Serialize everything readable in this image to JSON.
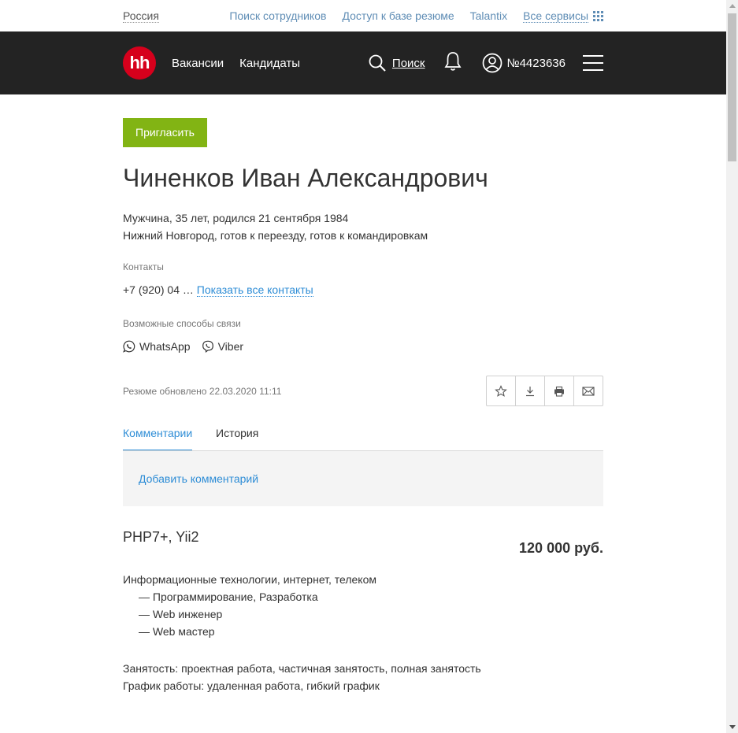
{
  "topbar": {
    "region": "Россия",
    "links": [
      "Поиск сотрудников",
      "Доступ к базе резюме",
      "Talantix"
    ],
    "all_services": "Все сервисы"
  },
  "header": {
    "logo": "hh",
    "nav": [
      "Вакансии",
      "Кандидаты"
    ],
    "search_label": "Поиск",
    "account_label": "№4423636"
  },
  "resume": {
    "invite_label": "Пригласить",
    "name": "Чиненков Иван Александрович",
    "personal_line1": "Мужчина, 35 лет, родился 21 сентября 1984",
    "personal_line2": "Нижний Новгород, готов к переезду, готов к командировкам",
    "contacts_label": "Контакты",
    "phone_partial": "+7 (920) 04 … ",
    "show_contacts": "Показать все контакты",
    "messengers_label": "Возможные способы связи",
    "messengers": [
      "WhatsApp",
      "Viber"
    ],
    "updated": "Резюме обновлено 22.03.2020 11:11",
    "tabs": [
      "Комментарии",
      "История"
    ],
    "add_comment": "Добавить комментарий",
    "position": "PHP7+, Yii2",
    "salary": "120 000 руб.",
    "industry": "Информационные технологии, интернет, телеком",
    "specializations": [
      "— Программирование, Разработка",
      "— Web инженер",
      "— Web мастер"
    ],
    "employment": "Занятость: проектная работа, частичная занятость, полная занятость",
    "schedule": "График работы: удаленная работа, гибкий график"
  },
  "colors": {
    "brand_red": "#d6001c",
    "invite_green": "#82b414",
    "link_blue": "#2e8dd6",
    "header_bg": "#232323"
  }
}
